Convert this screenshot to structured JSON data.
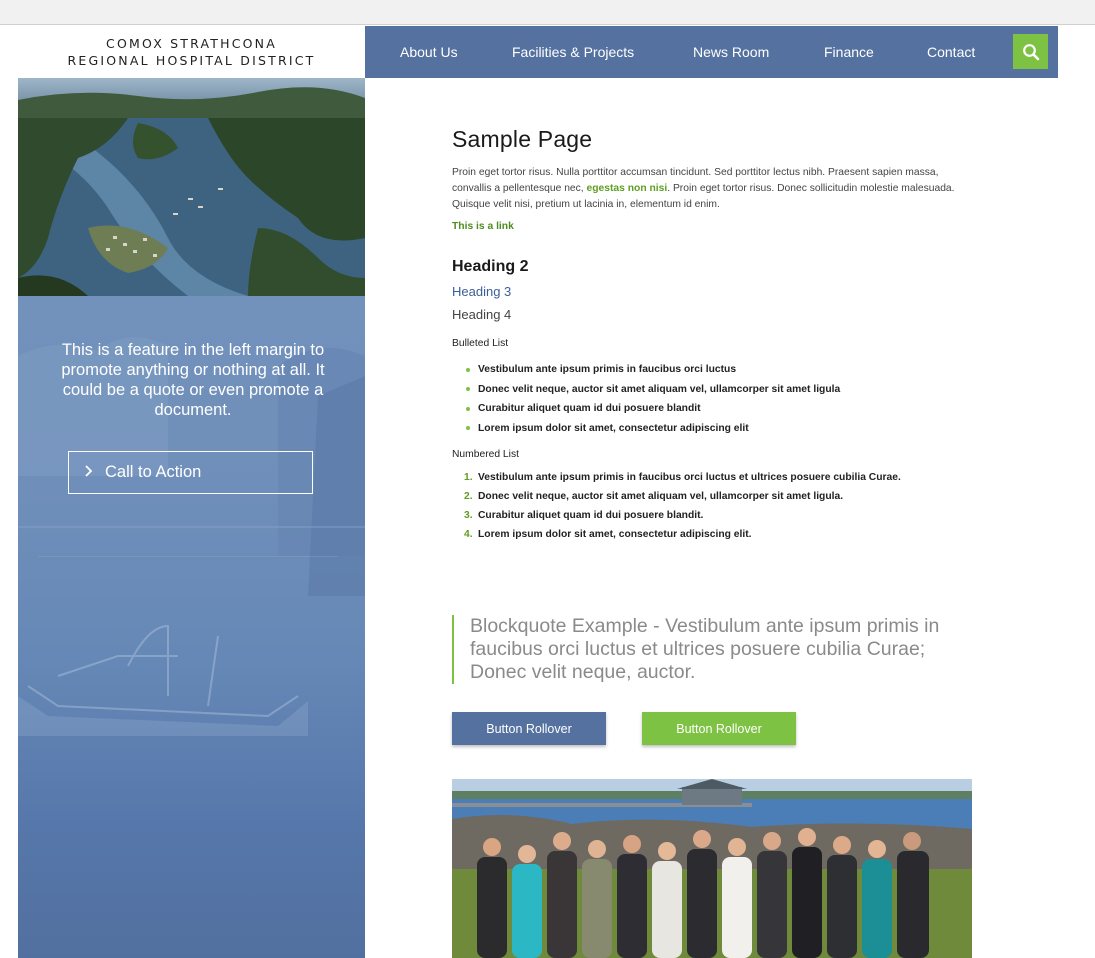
{
  "header": {
    "logo_line1": "COMOX STRATHCONA",
    "logo_line2": "REGIONAL HOSPITAL DISTRICT",
    "nav": [
      "About Us",
      "Facilities & Projects",
      "News Room",
      "Finance",
      "Contact"
    ],
    "search_icon": "search-icon"
  },
  "sidebar": {
    "feature_text": "This is a feature in the left margin to promote anything or nothing at all. It could be a quote or even promote a document.",
    "cta_label": "Call to Action",
    "cta_icon": "chevron-right-icon"
  },
  "content": {
    "title": "Sample Page",
    "para_part1": "Proin eget tortor risus. Nulla porttitor accumsan tincidunt. Sed porttitor lectus nibh. Praesent sapien massa, convallis a pellentesque nec, ",
    "para_link": "egestas non nisi",
    "para_part2": ". Proin eget tortor risus. Donec sollicitudin molestie malesuada. Quisque velit nisi, pretium ut lacinia in, elementum id enim.",
    "link": "This is a link",
    "h2": "Heading 2",
    "h3": "Heading 3",
    "h4": "Heading 4",
    "bulleted_label": "Bulleted List",
    "bulleted": [
      "Vestibulum ante ipsum primis in faucibus orci luctus",
      "Donec velit neque, auctor sit amet aliquam vel, ullamcorper sit amet ligula",
      "Curabitur aliquet quam id dui posuere blandit",
      "Lorem ipsum dolor sit amet, consectetur adipiscing elit"
    ],
    "numbered_label": "Numbered List",
    "numbered": [
      {
        "num": "1.",
        "text": "Vestibulum ante ipsum primis in faucibus orci luctus et ultrices posuere cubilia Curae."
      },
      {
        "num": "2.",
        "text": "Donec velit neque, auctor sit amet aliquam vel, ullamcorper sit amet ligula."
      },
      {
        "num": "3.",
        "text": "Curabitur aliquet quam id dui posuere blandit."
      },
      {
        "num": "4.",
        "text": "Lorem ipsum dolor sit amet, consectetur adipiscing elit."
      }
    ],
    "blockquote": "Blockquote Example - Vestibulum ante ipsum primis in faucibus orci luctus et ultrices posuere cubilia Curae; Donec velit neque, auctor.",
    "button1": "Button Rollover",
    "button2": "Button Rollover"
  },
  "colors": {
    "brand_blue": "#54719f",
    "accent_green": "#7dc242",
    "heading3_blue": "#3a5f98"
  }
}
